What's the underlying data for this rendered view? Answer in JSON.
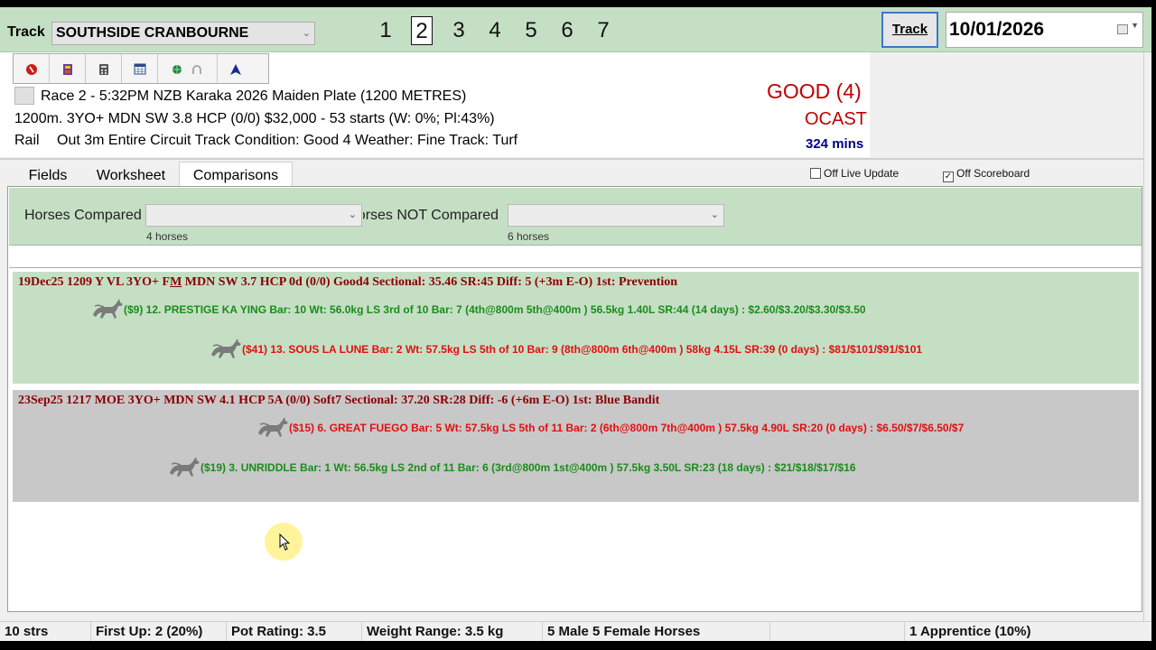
{
  "header": {
    "track_label": "Track",
    "track_value": "SOUTHSIDE CRANBOURNE",
    "race_numbers": [
      "1",
      "2",
      "3",
      "4",
      "5",
      "6",
      "7"
    ],
    "active_race": "2",
    "track_button": "Track",
    "date": "10/01/2026"
  },
  "race": {
    "line1": "Race 2  - 5:32PM NZB Karaka 2026 Maiden Plate (1200 METRES)",
    "line2": "1200m. 3YO+ MDN SW 3.8 HCP (0/0) $32,000 - 53 starts (W: 0%; Pl:43%)",
    "rail_label": "Rail",
    "line3": "Out 3m Entire Circuit Track Condition: Good 4 Weather: Fine Track: Turf",
    "condition": "GOOD (4)",
    "sky": "OCAST",
    "mins": "324 mins"
  },
  "tabs": [
    {
      "label": "Fields"
    },
    {
      "label": "Worksheet"
    },
    {
      "label": "Comparisons"
    }
  ],
  "options": {
    "live_update": "Off Live Update",
    "live_update_checked": false,
    "scoreboard": "Off Scoreboard",
    "scoreboard_checked": true
  },
  "filter": {
    "compared_label": "Horses Compared",
    "compared_count": "4 horses",
    "not_compared_label": "Horses NOT Compared",
    "not_compared_count": "6 horses"
  },
  "groups": [
    {
      "head_a": "19Dec25 1209 Y VL 3YO+ F",
      "head_u": "M",
      "head_b": " MDN SW 3.7 HCP 0d (0/0) Good4 Sectional: 35.46 SR:45 Diff: 5 (+3m E-O) 1st: Prevention",
      "runners": [
        {
          "result": "win",
          "text": "($9) 12. PRESTIGE KA YING Bar: 10 Wt: 56.0kg LS 3rd of 10 Bar: 7 (4th@800m  5th@400m ) 56.5kg 1.40L SR:44 (14 days) : $2.60/$3.20/$3.30/$3.50"
        },
        {
          "result": "lose",
          "text": "($41) 13. SOUS LA LUNE Bar: 2 Wt: 57.5kg LS 5th of 10 Bar: 9 (8th@800m  6th@400m ) 58kg 4.15L SR:39 (0 days) : $81/$101/$91/$101"
        }
      ]
    },
    {
      "head_a": "23Sep25 1217 MOE 3YO+ MDN SW 4.1 HCP 5A (0/0) Soft7 Sectional: 37.20 SR:28 Diff: -6 (+6m E-O) 1st: Blue Bandit",
      "head_u": "",
      "head_b": "",
      "runners": [
        {
          "result": "lose",
          "text": "($15) 6. GREAT FUEGO Bar: 5 Wt: 57.5kg LS 5th of 11 Bar: 2 (6th@800m  7th@400m ) 57.5kg 4.90L SR:20 (0 days) : $6.50/$7/$6.50/$7"
        },
        {
          "result": "win",
          "text": "($19) 3. UNRIDDLE Bar: 1 Wt: 56.5kg LS 2nd of 11 Bar: 6 (3rd@800m  1st@400m )  57.5kg 3.50L SR:23 (18 days) : $21/$18/$17/$16"
        }
      ]
    }
  ],
  "status": {
    "starters": "10 strs",
    "first_up": "First Up: 2 (20%)",
    "pot_rating": "Pot Rating: 3.5",
    "weight_range": "Weight Range: 3.5 kg",
    "sex_split": "5 Male 5 Female Horses",
    "apprentice": "1 Apprentice (10%)"
  },
  "colors": {
    "panel_green": "#c5dfc5",
    "panel_grey": "#c8c8c8",
    "win_text": "#1a8c1a",
    "lose_text": "#e01010",
    "heading_text": "#8b0000",
    "condition_red": "#c00000",
    "mins_blue": "#00008b"
  },
  "icons": [
    "stop-icon",
    "film-icon",
    "calculator-icon",
    "calendar-icon",
    "globe-icon",
    "horseshoe-icon",
    "navigation-arrow-icon",
    "horse-icon"
  ]
}
